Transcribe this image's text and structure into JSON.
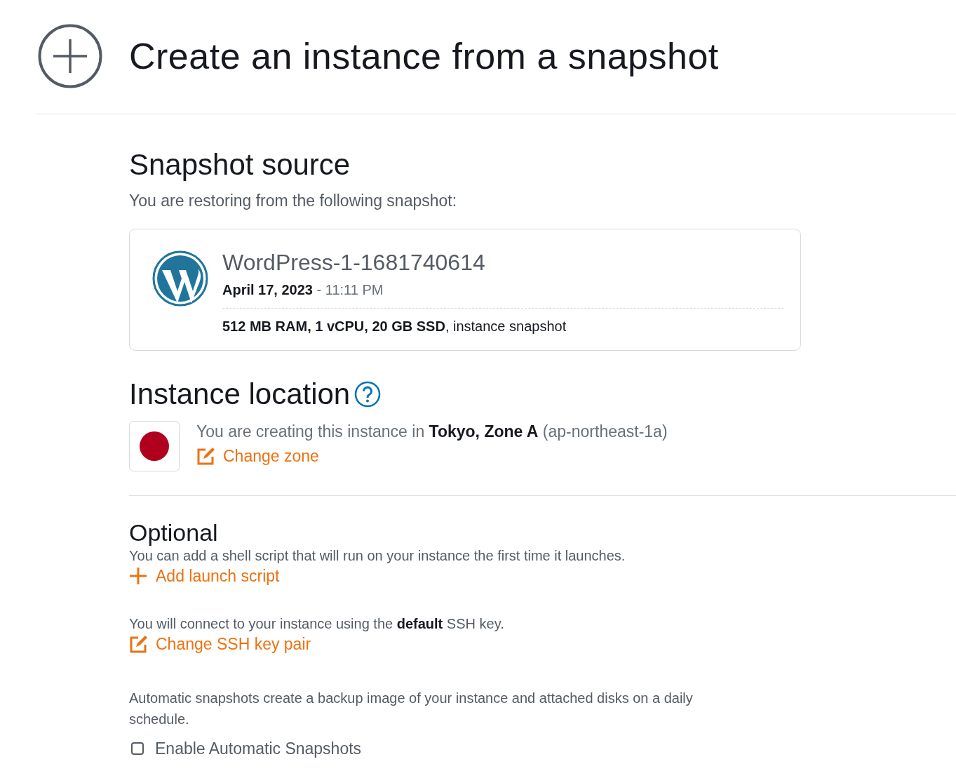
{
  "page_title": "Create an instance from a snapshot",
  "snapshot_source": {
    "heading": "Snapshot source",
    "intro": "You are restoring from the following snapshot:",
    "snapshot": {
      "name": "WordPress-1-1681740614",
      "date": "**April 17, 2023** - 11:11 PM",
      "specs": "**512 MB RAM, 1 vCPU, 20 GB SSD**, instance snapshot"
    }
  },
  "instance_location": {
    "heading": "Instance location",
    "text": "You are creating this instance in **Tokyo, Zone A** (ap-northeast-1a)",
    "link": {
      "label": "Change zone",
      "kind": "edit"
    }
  },
  "optional": {
    "heading": "Optional",
    "blocks": [
      {
        "text": "You can add a shell script that will run on your instance the first time it launches.",
        "link": {
          "label": "Add launch script",
          "kind": "add"
        }
      },
      {
        "text": "You will connect to your instance using the **default** SSH key.",
        "link": {
          "label": "Change SSH key pair",
          "kind": "edit"
        }
      }
    ],
    "auto_snapshots": {
      "text": "Automatic snapshots create a backup image of your instance and attached disks on a daily schedule.",
      "checkbox": {
        "label": "Enable Automatic Snapshots",
        "checked": false
      }
    }
  }
}
